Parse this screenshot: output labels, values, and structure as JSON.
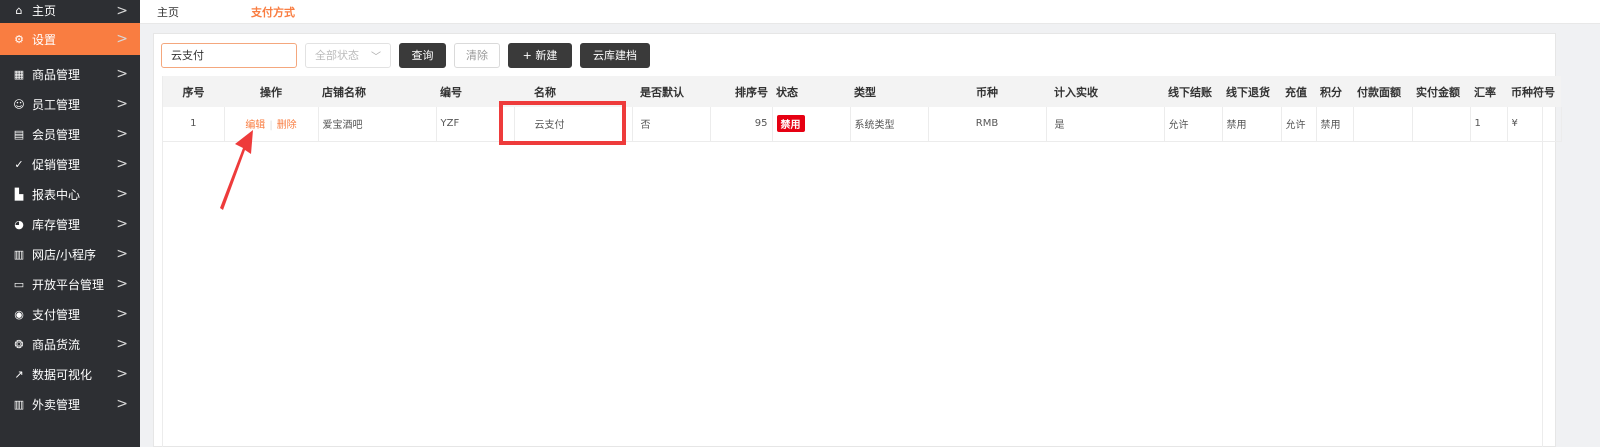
{
  "sidebar": {
    "items": [
      {
        "label": "主页",
        "icon": "home-icon",
        "glyph": "⌂"
      },
      {
        "label": "设置",
        "icon": "gear-icon",
        "glyph": "⚙"
      },
      {
        "label": "商品管理",
        "icon": "grid-icon",
        "glyph": "▦"
      },
      {
        "label": "员工管理",
        "icon": "user-icon",
        "glyph": "☺"
      },
      {
        "label": "会员管理",
        "icon": "member-card-icon",
        "glyph": "▤"
      },
      {
        "label": "促销管理",
        "icon": "check-circle-icon",
        "glyph": "✓"
      },
      {
        "label": "报表中心",
        "icon": "bar-chart-icon",
        "glyph": "▙"
      },
      {
        "label": "库存管理",
        "icon": "pie-chart-icon",
        "glyph": "◕"
      },
      {
        "label": "网店/小程序",
        "icon": "store-icon",
        "glyph": "▥"
      },
      {
        "label": "开放平台管理",
        "icon": "monitor-icon",
        "glyph": "▭"
      },
      {
        "label": "支付管理",
        "icon": "payment-icon",
        "glyph": "◉"
      },
      {
        "label": "商品货流",
        "icon": "flow-icon",
        "glyph": "❂"
      },
      {
        "label": "数据可视化",
        "icon": "line-chart-icon",
        "glyph": "↗"
      },
      {
        "label": "外卖管理",
        "icon": "takeout-icon",
        "glyph": "▥"
      }
    ],
    "chevron": ">"
  },
  "breadcrumb": {
    "home": "主页",
    "current": "支付方式"
  },
  "toolbar": {
    "search_value": "云支付",
    "status_select": "全部状态",
    "query_label": "查询",
    "clear_label": "清除",
    "new_label": "+ 新建",
    "cloud_label": "云库建档"
  },
  "table": {
    "headers": [
      "序号",
      "操作",
      "店铺名称",
      "编号",
      "名称",
      "是否默认",
      "排序号",
      "状态",
      "类型",
      "币种",
      "计入实收",
      "线下结账",
      "线下退货",
      "充值",
      "积分",
      "付款面额",
      "实付金额",
      "汇率",
      "币种符号"
    ],
    "rows": [
      {
        "index": "1",
        "edit": "编辑",
        "delete": "删除",
        "store": "爱宝酒吧",
        "code": "YZF",
        "name": "云支付",
        "is_default": "否",
        "sort": "95",
        "status": "禁用",
        "type": "系统类型",
        "currency": "RMB",
        "count_revenue": "是",
        "offline_checkout": "允许",
        "offline_return": "禁用",
        "recharge": "允许",
        "points": "禁用",
        "face_value": "",
        "paid_amount": "",
        "rate": "1",
        "currency_symbol": "¥"
      }
    ]
  },
  "colors": {
    "accent": "#f97d41",
    "sidebar_bg": "#2d2f33",
    "danger": "#e60012",
    "annotation": "#ee3b3b"
  }
}
